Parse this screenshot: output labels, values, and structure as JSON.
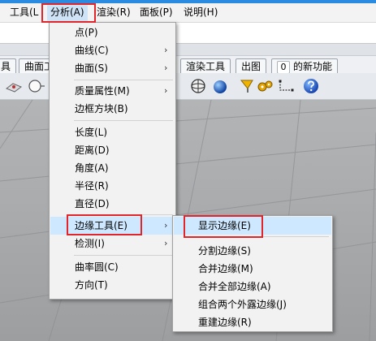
{
  "menubar": {
    "items": [
      "工具(L",
      "分析(A)",
      "渲染(R)",
      "面板(P)",
      "说明(H)"
    ]
  },
  "tabs": {
    "items": [
      "具",
      "曲面工",
      "渲染工具",
      "出图"
    ],
    "new_tab": {
      "count": "0",
      "label": "的新功能"
    }
  },
  "analysis_menu": {
    "items": [
      "点(P)",
      "曲线(C)",
      "曲面(S)",
      "质量属性(M)",
      "边框方块(B)",
      "长度(L)",
      "距离(D)",
      "角度(A)",
      "半径(R)",
      "直径(D)",
      "边缘工具(E)",
      "检测(I)",
      "曲率圆(C)",
      "方向(T)"
    ]
  },
  "edge_tools_submenu": {
    "items": [
      "显示边缘(E)",
      "分割边缘(S)",
      "合并边缘(M)",
      "合并全部边缘(A)",
      "组合两个外露边缘(J)",
      "重建边缘(R)"
    ]
  },
  "colors": {
    "highlight": "#cde8ff",
    "annotation_red": "#e0262b",
    "menu_background": "#f2f2f2",
    "viewport_grey": "#a9abad"
  }
}
